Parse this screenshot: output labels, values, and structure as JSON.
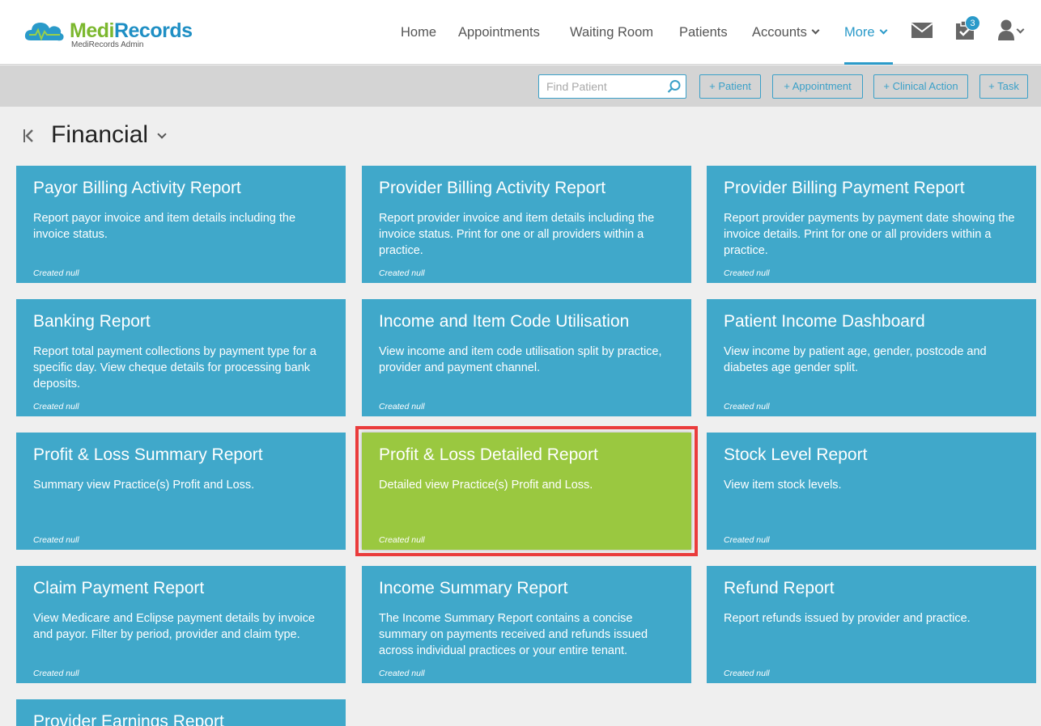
{
  "app": {
    "logo_medi": "Medi",
    "logo_records": "Records",
    "logo_subtitle": "MediRecords Admin"
  },
  "nav": {
    "items": [
      {
        "label": "Home"
      },
      {
        "label": "Appointments"
      },
      {
        "label": "Waiting Room"
      },
      {
        "label": "Patients"
      },
      {
        "label": "Accounts",
        "dropdown": true
      },
      {
        "label": "More",
        "dropdown": true,
        "active": true
      }
    ],
    "icons": [
      "mail-icon",
      "tasks-icon",
      "user-icon"
    ],
    "task_badge": "3"
  },
  "actionbar": {
    "find_placeholder": "Find Patient",
    "buttons": [
      "+ Patient",
      "+ Appointment",
      "+ Clinical Action",
      "+ Task"
    ]
  },
  "page": {
    "title": "Financial"
  },
  "cards": [
    {
      "title": "Payor Billing Activity Report",
      "desc": "Report payor invoice and item details including the invoice status.",
      "meta": "Created null"
    },
    {
      "title": "Provider Billing Activity Report",
      "desc": "Report provider invoice and item details including the invoice status. Print for one or all providers within a practice.",
      "meta": "Created null"
    },
    {
      "title": "Provider Billing Payment Report",
      "desc": "Report provider payments by payment date showing the invoice details. Print for one or all providers within a practice.",
      "meta": "Created null"
    },
    {
      "title": "Banking Report",
      "desc": "Report total payment collections by payment type for a specific day. View cheque details for processing bank deposits.",
      "meta": "Created null"
    },
    {
      "title": "Income and Item Code Utilisation",
      "desc": "View income and item code utilisation split by practice, provider and payment channel.",
      "meta": "Created null"
    },
    {
      "title": "Patient Income Dashboard",
      "desc": "View income by patient age, gender, postcode and diabetes age gender split.",
      "meta": "Created null"
    },
    {
      "title": "Profit & Loss Summary Report",
      "desc": "Summary view Practice(s) Profit and Loss.",
      "meta": "Created null"
    },
    {
      "title": "Profit & Loss Detailed Report",
      "desc": "Detailed view Practice(s) Profit and Loss.",
      "meta": "Created null",
      "selected": true
    },
    {
      "title": "Stock Level Report",
      "desc": "View item stock levels.",
      "meta": "Created null"
    },
    {
      "title": "Claim Payment Report",
      "desc": "View Medicare and Eclipse payment details by invoice and payor. Filter by period, provider and claim type.",
      "meta": "Created null"
    },
    {
      "title": "Income Summary Report",
      "desc": "The Income Summary Report contains a concise summary on payments received and refunds issued across individual practices or your entire tenant.",
      "meta": "Created null"
    },
    {
      "title": "Refund Report",
      "desc": "Report refunds issued by provider and practice.",
      "meta": "Created null"
    },
    {
      "title": "Provider Earnings Report",
      "desc": "",
      "meta": ""
    }
  ],
  "colors": {
    "card": "#40a8ca",
    "card_selected": "#9ac840",
    "highlight": "#ea3c3c",
    "accent": "#2a9ac9"
  }
}
